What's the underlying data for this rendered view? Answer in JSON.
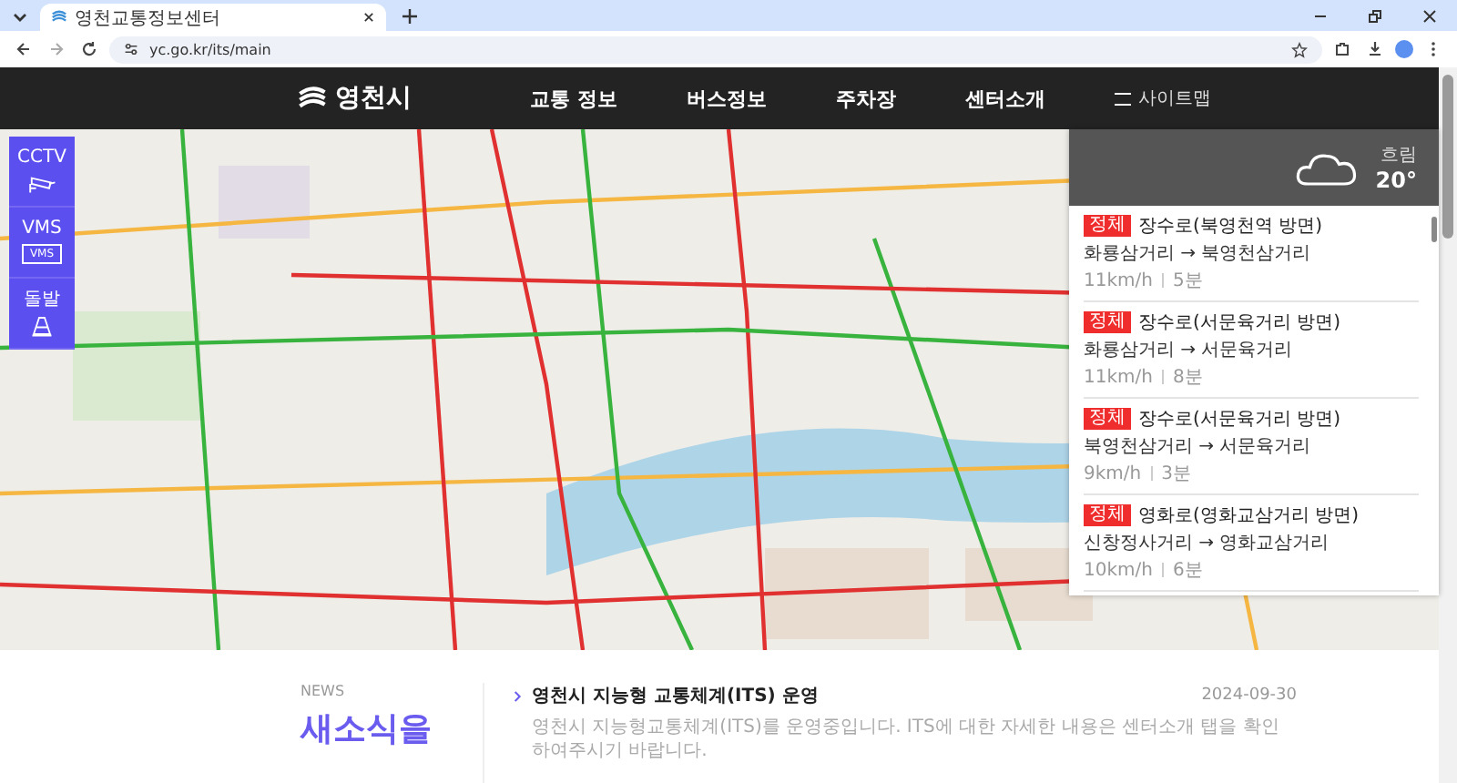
{
  "browser": {
    "tab_title": "영천교통정보센터",
    "url": "yc.go.kr/its/main"
  },
  "header": {
    "logo": "영천시",
    "nav": [
      {
        "label": "교통 정보"
      },
      {
        "label": "버스정보"
      },
      {
        "label": "주차장"
      },
      {
        "label": "센터소개"
      }
    ],
    "sitemap": "사이트맵"
  },
  "sidebar": {
    "items": [
      {
        "label": "CCTV",
        "kind": "cctv"
      },
      {
        "label": "VMS",
        "kind": "vms",
        "sign_text": "VMS"
      },
      {
        "label": "돌발",
        "kind": "incident"
      }
    ]
  },
  "weather": {
    "condition": "흐림",
    "temperature": "20°"
  },
  "traffic": [
    {
      "status": "정체",
      "road": "장수로(북영천역 방면)",
      "route": "화룡삼거리 → 북영천삼거리",
      "speed": "11km/h",
      "time": "5분"
    },
    {
      "status": "정체",
      "road": "장수로(서문육거리 방면)",
      "route": "화룡삼거리 → 서문육거리",
      "speed": "11km/h",
      "time": "8분"
    },
    {
      "status": "정체",
      "road": "장수로(서문육거리 방면)",
      "route": "북영천삼거리 → 서문육거리",
      "speed": "9km/h",
      "time": "3분"
    },
    {
      "status": "정체",
      "road": "영화로(영화교삼거리 방면)",
      "route": "신창정사거리 → 영화교삼거리",
      "speed": "10km/h",
      "time": "6분"
    }
  ],
  "news": {
    "label": "NEWS",
    "heading": "새소식을",
    "items": [
      {
        "title": "영천시 지능형 교통체계(ITS) 운영",
        "date": "2024-09-30",
        "summary": "영천시 지능형교통체계(ITS)를 운영중입니다. ITS에 대한 자세한 내용은 센터소개 탭을 확인하여주시기 바랍니다."
      }
    ]
  }
}
